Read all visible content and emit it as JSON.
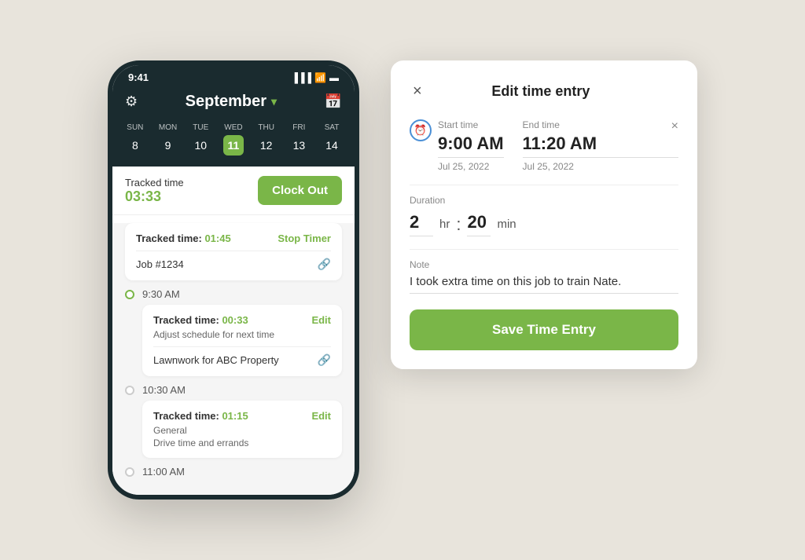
{
  "phone": {
    "status_time": "9:41",
    "header_title": "September",
    "calendar": {
      "days": [
        {
          "label": "SUN",
          "num": "8",
          "active": false
        },
        {
          "label": "MON",
          "num": "9",
          "active": false
        },
        {
          "label": "TUE",
          "num": "10",
          "active": false
        },
        {
          "label": "WED",
          "num": "11",
          "active": true
        },
        {
          "label": "THU",
          "num": "12",
          "active": false
        },
        {
          "label": "FRI",
          "num": "13",
          "active": false
        },
        {
          "label": "SAT",
          "num": "14",
          "active": false
        }
      ]
    },
    "tracked_label": "Tracked time",
    "tracked_time": "03:33",
    "clock_out_label": "Clock Out",
    "entries": [
      {
        "tracked_label": "Tracked time:",
        "tracked_time": "01:45",
        "action": "Stop Timer",
        "job": "Job #1234"
      },
      {
        "time": "9:30 AM",
        "tracked_label": "Tracked time:",
        "tracked_time": "00:33",
        "action": "Edit",
        "desc": "Adjust schedule for next time",
        "job": "Lawnwork for ABC Property"
      },
      {
        "time": "10:30 AM",
        "tracked_label": "Tracked time:",
        "tracked_time": "01:15",
        "action": "Edit",
        "desc1": "General",
        "desc2": "Drive time and errands"
      },
      {
        "time": "11:00 AM"
      }
    ]
  },
  "modal": {
    "title": "Edit time entry",
    "close_label": "×",
    "start_label": "Start time",
    "start_time": "9:00 AM",
    "start_date": "Jul 25, 2022",
    "end_label": "End time",
    "end_time": "11:20 AM",
    "end_date": "Jul 25, 2022",
    "duration_label": "Duration",
    "duration_hr": "2",
    "hr_unit": "hr",
    "duration_min": "20",
    "min_unit": "min",
    "note_label": "Note",
    "note_value": "I took extra time on this job to train Nate.",
    "save_label": "Save Time Entry"
  }
}
